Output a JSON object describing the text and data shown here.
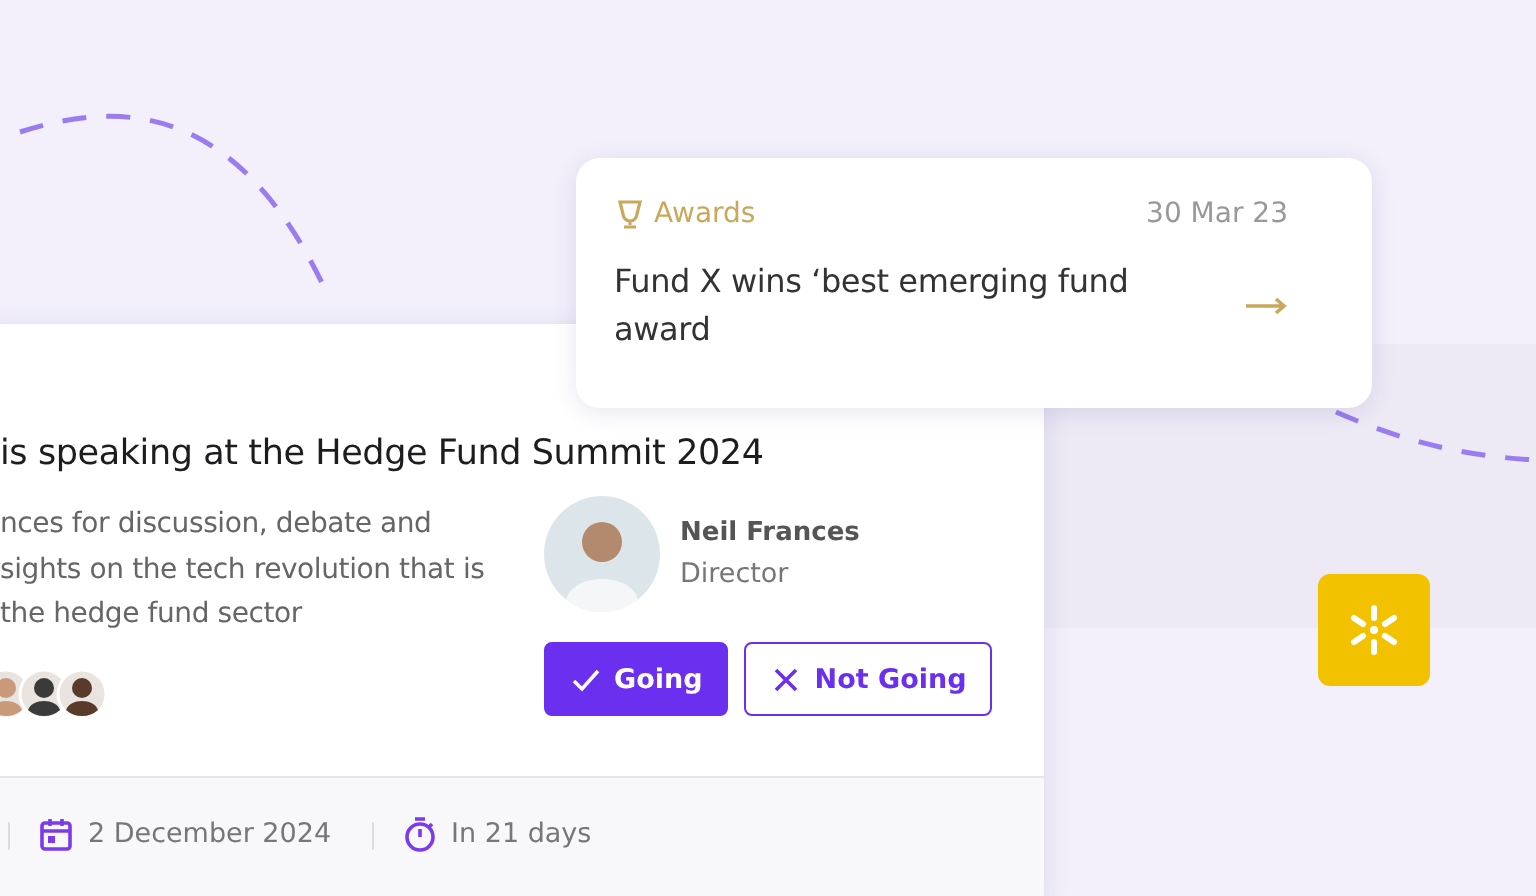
{
  "award_card": {
    "category": "Awards",
    "date": "30 Mar 23",
    "headline": "Fund X wins ‘best emerging fund award"
  },
  "event_card": {
    "title": "is speaking at the Hedge Fund Summit 2024",
    "description": [
      "nces for discussion, debate and",
      "sights on the tech revolution that is",
      "the hedge fund sector"
    ],
    "speaker": {
      "name": "Neil Frances",
      "role": "Director"
    },
    "rsvp": [
      {
        "label": "Going",
        "kind": "check",
        "selected": true
      },
      {
        "label": "Not Going",
        "kind": "cross",
        "selected": false
      }
    ],
    "footer": [
      {
        "kind": "date",
        "text": "2 December 2024"
      },
      {
        "kind": "countdown",
        "text": "In 21 days"
      }
    ]
  }
}
